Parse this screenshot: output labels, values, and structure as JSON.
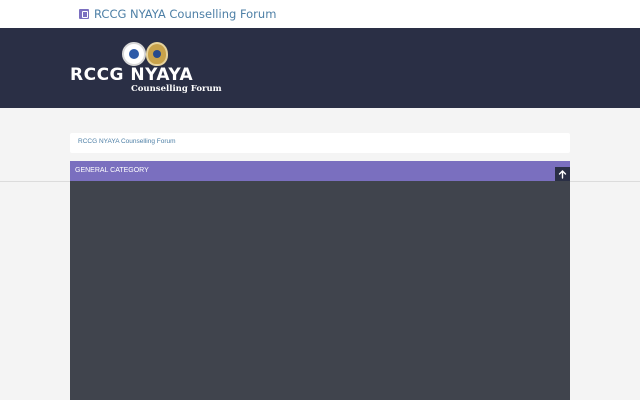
{
  "header": {
    "site_title": "RCCG NYAYA Counselling Forum",
    "logo": {
      "name": "RCCG NYAYA",
      "subtitle": "Counselling Forum"
    }
  },
  "breadcrumb": {
    "items": [
      {
        "label": "RCCG NYAYA Counselling Forum"
      }
    ]
  },
  "category": {
    "title": "GENERAL CATEGORY",
    "collapse_icon": "arrow-up-icon"
  },
  "colors": {
    "banner_bg": "#2a2f45",
    "category_header": "#7a6fbf",
    "category_body": "#40444d",
    "link": "#4d7fa6",
    "page_bg": "#f4f4f4"
  }
}
